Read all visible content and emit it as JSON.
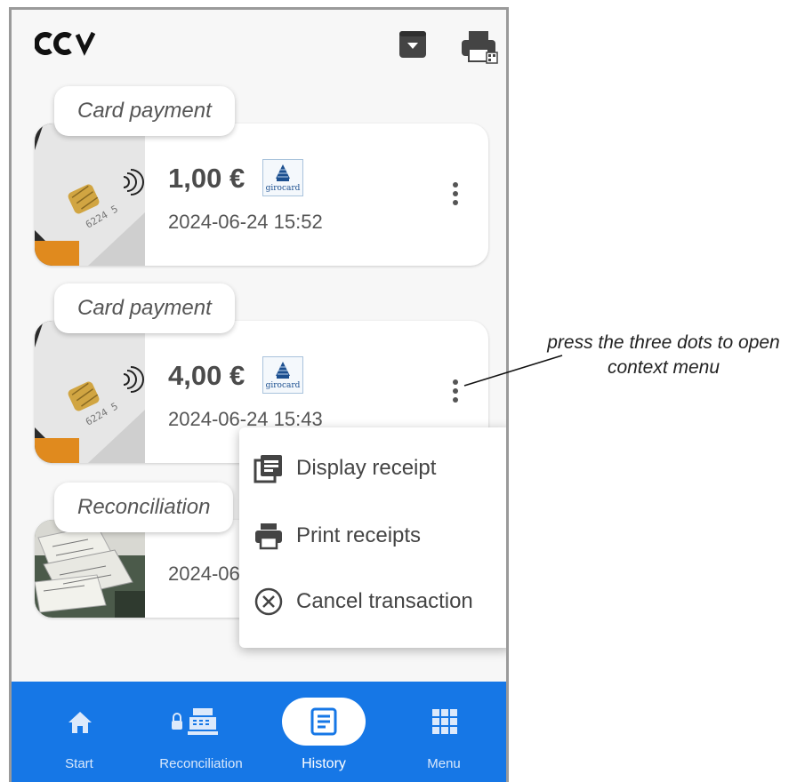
{
  "app": {
    "logo": "CCV"
  },
  "header": {
    "archive_icon": "archive-download-icon",
    "printer_icon": "printer-qr-icon"
  },
  "transactions": [
    {
      "tag": "Card payment",
      "amount": "1,00 €",
      "brand": "girocard",
      "date": "2024-06-24 15:52",
      "thumb": "bank-card-photo"
    },
    {
      "tag": "Card payment",
      "amount": "4,00 €",
      "brand": "girocard",
      "date": "2024-06-24 15:43",
      "thumb": "bank-card-photo"
    },
    {
      "tag": "Reconciliation",
      "date": "2024-06",
      "thumb": "receipts-pile-photo"
    }
  ],
  "context_menu": {
    "items": [
      {
        "label": "Display receipt",
        "icon": "receipt-list-icon"
      },
      {
        "label": "Print receipts",
        "icon": "printer-icon"
      },
      {
        "label": "Cancel transaction",
        "icon": "cancel-circle-icon"
      }
    ]
  },
  "nav": {
    "items": [
      {
        "label": "Start",
        "icon": "home-icon"
      },
      {
        "label": "Reconciliation",
        "icon": "locked-register-icon"
      },
      {
        "label": "History",
        "icon": "document-list-icon",
        "active": true
      },
      {
        "label": "Menu",
        "icon": "grid-icon"
      }
    ],
    "color": "#1677e6"
  },
  "annotation": {
    "line1": "press the three dots to open",
    "line2": "context menu"
  }
}
